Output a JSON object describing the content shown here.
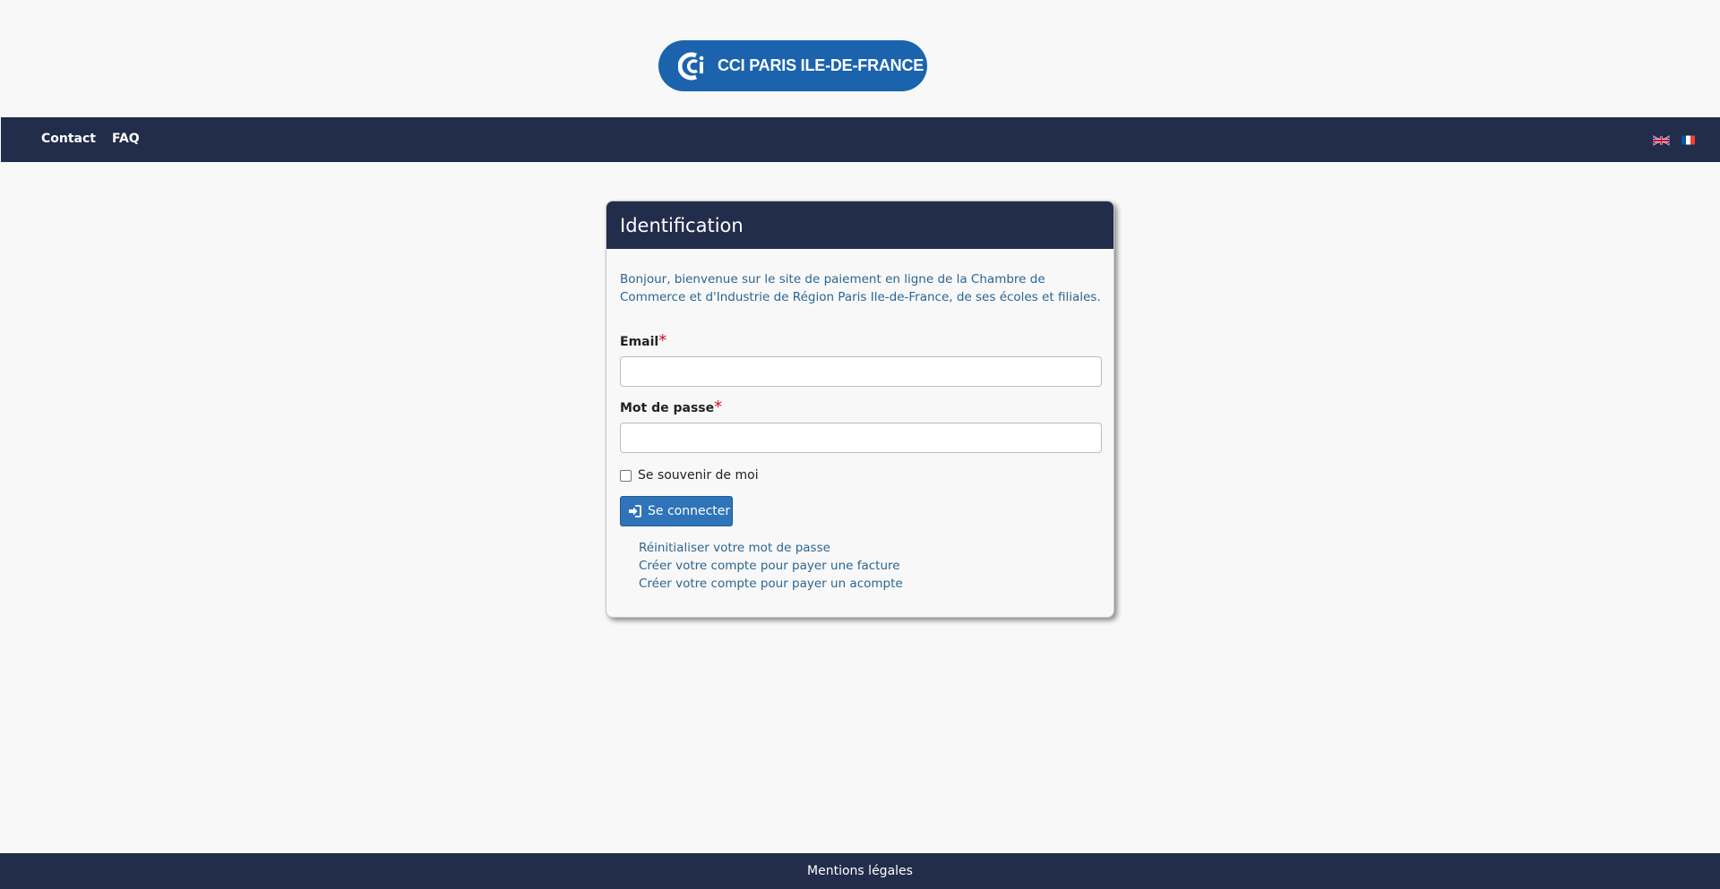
{
  "logo": {
    "text": "CCI PARIS ILE-DE-FRANCE"
  },
  "nav": {
    "contact": "Contact",
    "faq": "FAQ",
    "languages": [
      "english-flag-icon",
      "french-flag-icon"
    ]
  },
  "panel": {
    "title": "Identification",
    "intro": "Bonjour, bienvenue sur le site de paiement en ligne de la Chambre de Commerce et d'Industrie de Région Paris Ile-de-France, de ses écoles et filiales.",
    "email_label": "Email",
    "password_label": "Mot de passe",
    "required_mark": "*",
    "remember_label": "Se souvenir de moi",
    "submit_label": "Se connecter",
    "links": {
      "reset": "Réinitialiser votre mot de passe",
      "create_invoice": "Créer votre compte pour payer une facture",
      "create_deposit": "Créer votre compte pour payer un acompte"
    }
  },
  "footer": {
    "legal": "Mentions légales"
  },
  "colors": {
    "navy": "#222d4b",
    "brand_blue": "#1b64ad",
    "button_blue": "#2f73b8",
    "link_blue": "#2b6591",
    "required_red": "#c8102e"
  }
}
